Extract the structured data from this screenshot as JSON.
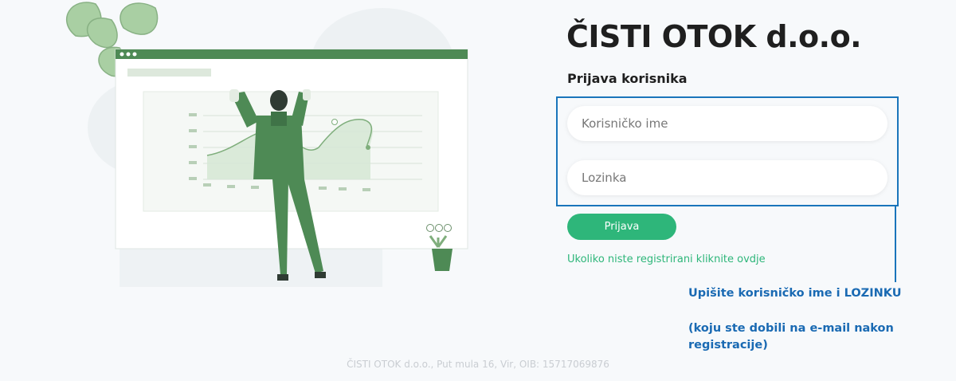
{
  "header": {
    "company_name": "ČISTI OTOK d.o.o.",
    "login_heading": "Prijava korisnika"
  },
  "form": {
    "username_placeholder": "Korisničko ime",
    "password_placeholder": "Lozinka",
    "submit_label": "Prijava",
    "register_link": "Ukoliko niste registrirani kliknite ovdje"
  },
  "annotation": {
    "line1": "Upišite korisničko ime i LOZINKU",
    "line2": "(koju ste dobili na e-mail nakon registracije)"
  },
  "footer": {
    "text": "ČISTI OTOK d.o.o., Put mula 16, Vir, OIB: 15717069876"
  },
  "colors": {
    "accent_green": "#2eb67a",
    "annotation_blue": "#1a75bb",
    "illustration_green": "#4e8a55"
  },
  "illustration": {
    "icon": "person-presenting-chart-illustration",
    "browser_dots": [
      "dot",
      "dot",
      "dot"
    ]
  }
}
